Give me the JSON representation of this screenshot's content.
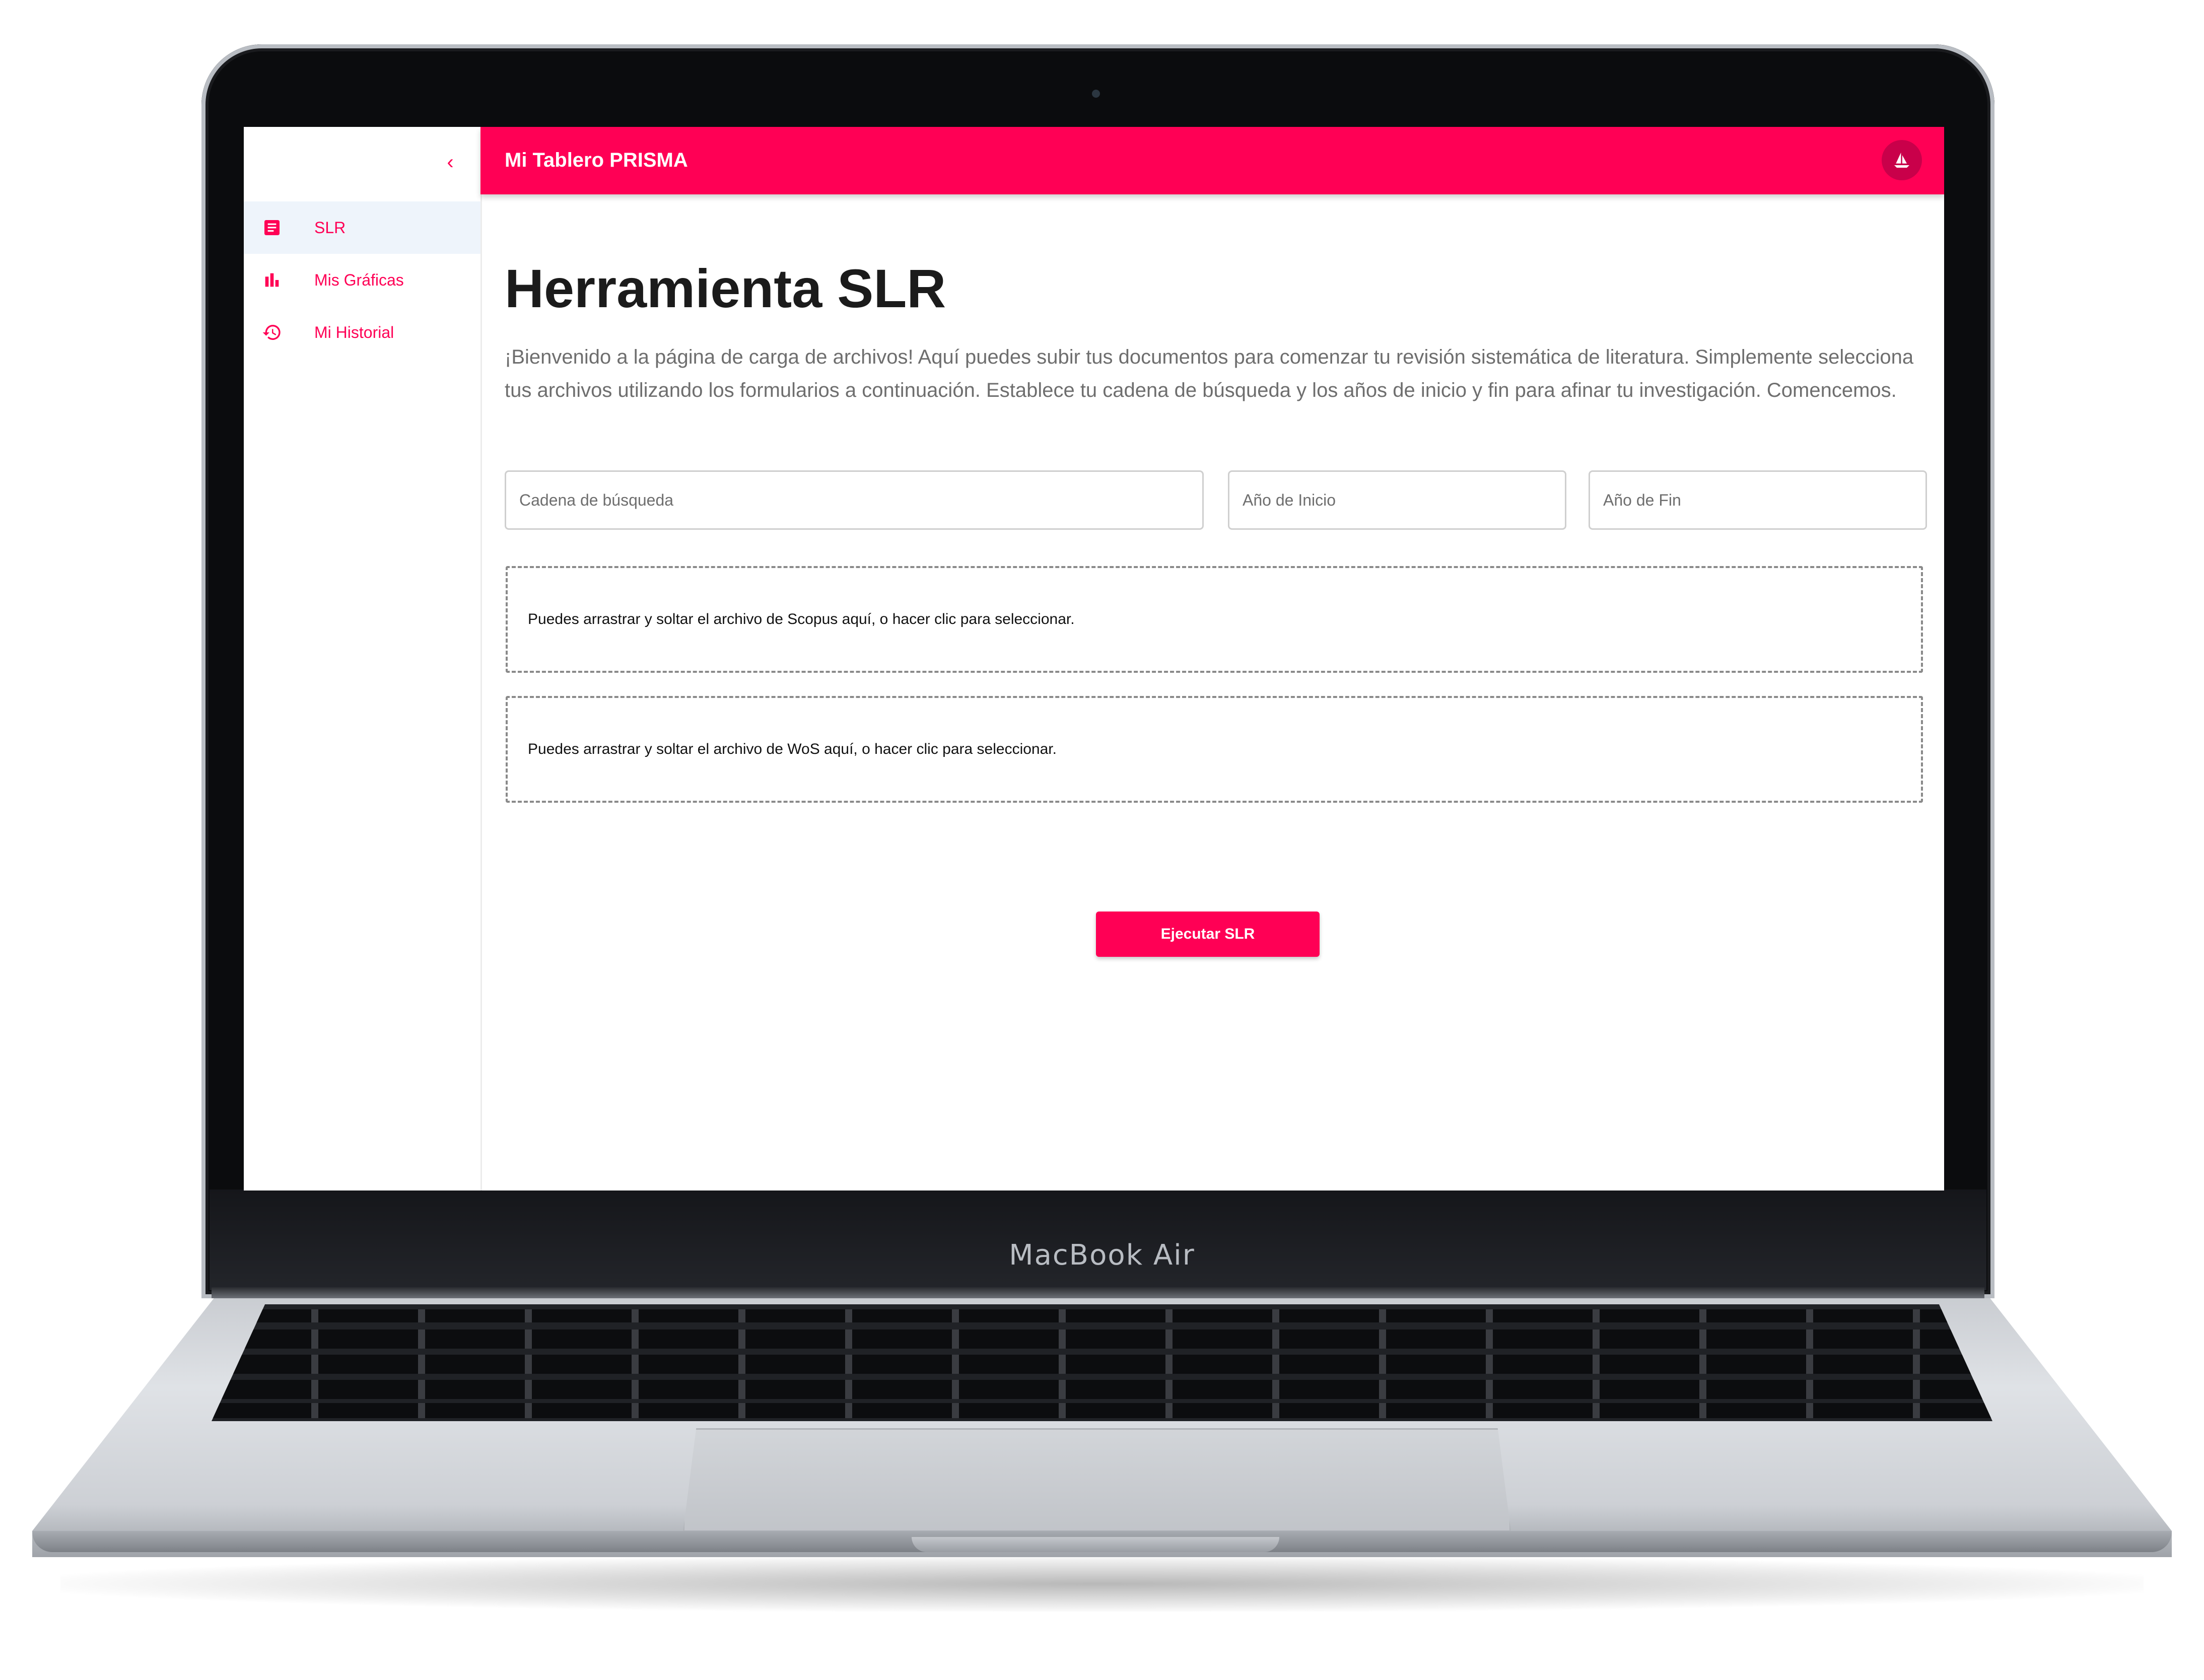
{
  "device": {
    "brand_label": "MacBook Air"
  },
  "sidebar": {
    "collapse_icon": "chevron-left-icon",
    "items": [
      {
        "id": "slr",
        "label": "SLR",
        "icon": "article-icon",
        "active": true
      },
      {
        "id": "graficas",
        "label": "Mis Gráficas",
        "icon": "bar-chart-icon",
        "active": false
      },
      {
        "id": "historial",
        "label": "Mi Historial",
        "icon": "history-icon",
        "active": false
      }
    ]
  },
  "appbar": {
    "title": "Mi Tablero PRISMA",
    "avatar_icon": "sailboat-icon"
  },
  "main": {
    "title": "Herramienta SLR",
    "intro": "¡Bienvenido a la página de carga de archivos! Aquí puedes subir tus documentos para comenzar tu revisión sistemática de literatura. Simplemente selecciona tus archivos utilizando los formularios a continuación. Establece tu cadena de búsqueda y los años de inicio y fin para afinar tu investigación. Comencemos.",
    "form": {
      "search": {
        "value": "",
        "placeholder": "Cadena de búsqueda"
      },
      "start_year": {
        "value": "",
        "placeholder": "Año de Inicio"
      },
      "end_year": {
        "value": "",
        "placeholder": "Año de Fin"
      }
    },
    "dropzones": {
      "scopus": "Puedes arrastrar y soltar el archivo de Scopus aquí, o hacer clic para seleccionar.",
      "wos": "Puedes arrastrar y soltar el archivo de WoS aquí, o hacer clic para seleccionar."
    },
    "run_button": "Ejecutar SLR"
  },
  "colors": {
    "accent": "#ff0055",
    "active_nav_bg": "#eef4fb",
    "text_muted": "#6e6e6e"
  }
}
